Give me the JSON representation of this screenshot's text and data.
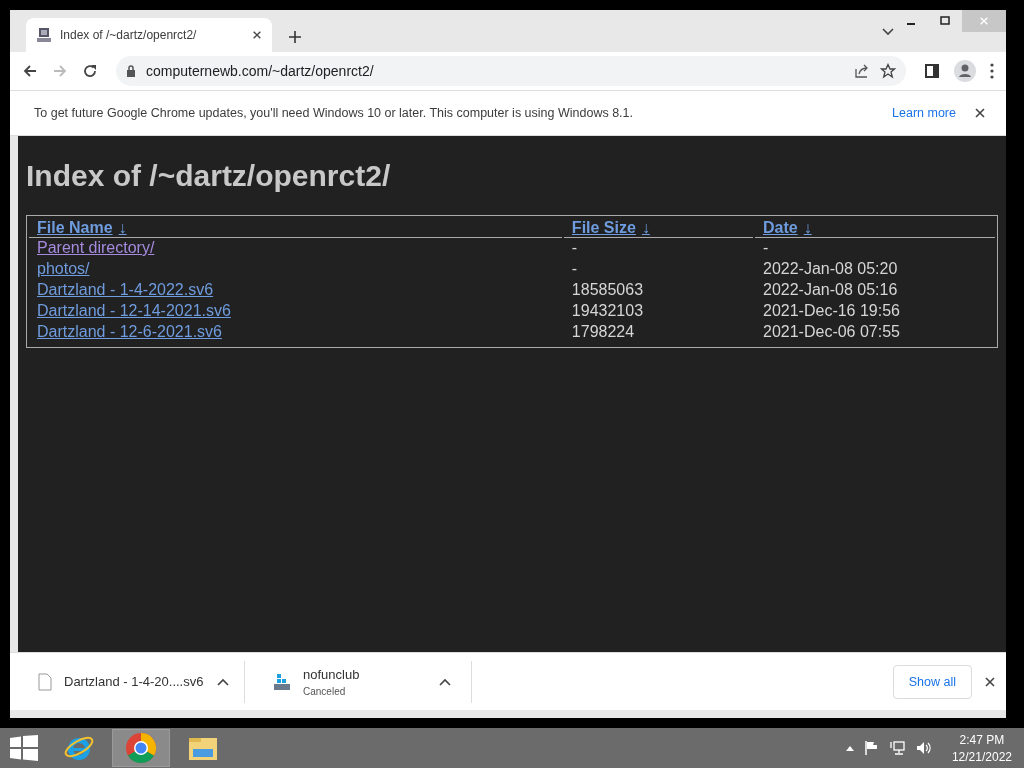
{
  "browser": {
    "tab": {
      "title": "Index of /~dartz/openrct2/",
      "selected": true
    },
    "address": "computernewb.com/~dartz/openrct2/",
    "infobar": {
      "message": "To get future Google Chrome updates, you'll need Windows 10 or later. This computer is using Windows 8.1.",
      "link": "Learn more"
    }
  },
  "page": {
    "heading": "Index of /~dartz/openrct2/",
    "columns": [
      {
        "label": "File Name",
        "sort": "↓"
      },
      {
        "label": "File Size",
        "sort": "↓"
      },
      {
        "label": "Date",
        "sort": "↓"
      }
    ],
    "rows": [
      {
        "name": "Parent directory/",
        "visited": true,
        "size": "-",
        "date": "-"
      },
      {
        "name": "photos/",
        "visited": false,
        "size": "-",
        "date": "2022-Jan-08 05:20"
      },
      {
        "name": "Dartzland - 1-4-2022.sv6",
        "visited": false,
        "size": "18585063",
        "date": "2022-Jan-08 05:16"
      },
      {
        "name": "Dartzland - 12-14-2021.sv6",
        "visited": false,
        "size": "19432103",
        "date": "2021-Dec-16 19:56"
      },
      {
        "name": "Dartzland - 12-6-2021.sv6",
        "visited": false,
        "size": "1798224",
        "date": "2021-Dec-06 07:55"
      }
    ]
  },
  "downloads": {
    "items": [
      {
        "kind": "file",
        "name": "Dartzland - 1-4-20....sv6"
      },
      {
        "kind": "installer",
        "name": "nofunclub",
        "status": "Canceled"
      }
    ],
    "show_all": "Show all"
  },
  "taskbar": {
    "apps": [
      {
        "kind": "ie",
        "selected": false
      },
      {
        "kind": "chrome",
        "selected": true
      },
      {
        "kind": "explorer",
        "selected": false
      }
    ],
    "time": "2:47 PM",
    "date": "12/21/2022"
  }
}
